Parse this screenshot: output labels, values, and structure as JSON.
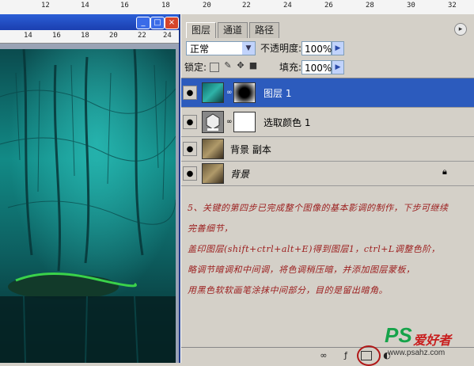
{
  "top_ruler": {
    "ticks": [
      "12",
      "14",
      "16",
      "18",
      "20",
      "22",
      "24",
      "26",
      "28",
      "30",
      "32"
    ]
  },
  "doc_window": {
    "ruler": [
      "14",
      "16",
      "18",
      "20",
      "22",
      "24"
    ]
  },
  "palette": {
    "tabs": [
      "图层",
      "通道",
      "路径"
    ],
    "blend_mode": "正常",
    "opacity_label": "不透明度:",
    "opacity_value": "100%",
    "lock_label": "锁定:",
    "fill_label": "填充:",
    "fill_value": "100%",
    "layers": [
      {
        "name": "图层 1",
        "selected": true
      },
      {
        "name": "选取颜色 1",
        "selected": false
      },
      {
        "name": "背景 副本",
        "selected": false
      },
      {
        "name": "背景",
        "selected": false
      }
    ]
  },
  "tutorial": {
    "lines": [
      "5、关键的第四步已完成整个图像的基本影调的制作，下步可继续",
      "完善细节，",
      "盖印图层(shift+ctrl+alt+E)得到图层1，ctrl+L调整色阶，",
      "略调节暗调和中间调，将色调稍压暗，并添加图层蒙板，",
      "用黑色软软画笔涂抹中间部分，目的是留出暗角。"
    ]
  },
  "watermark": {
    "ps": "PS",
    "cn": "爱好者",
    "url": "www.psahz.com"
  },
  "colors": {
    "selected_layer": "#2c5bbd",
    "tutorial_text": "#9b1c1c",
    "titlebar": "#2b5fd6"
  }
}
